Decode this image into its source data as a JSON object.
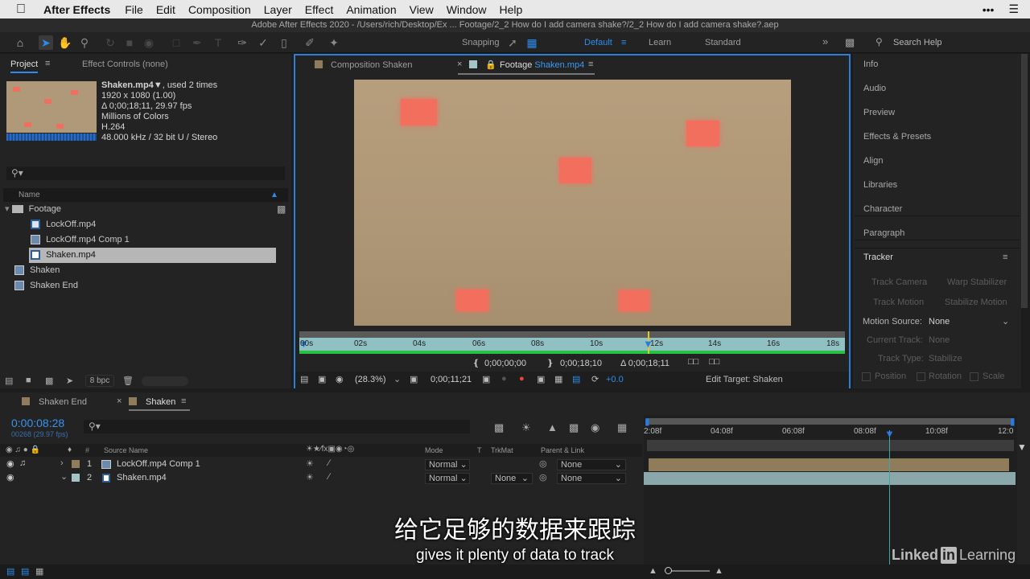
{
  "menubar": {
    "app_name": "After Effects",
    "items": [
      "File",
      "Edit",
      "Composition",
      "Layer",
      "Effect",
      "Animation",
      "View",
      "Window",
      "Help"
    ]
  },
  "window_title": "Adobe After Effects 2020 - /Users/rich/Desktop/Ex ... Footage/2_2 How do I add camera shake?/2_2 How do I add camera shake?.aep",
  "toolbar": {
    "snapping_label": "Snapping",
    "workspaces": [
      "Default",
      "Learn",
      "Standard"
    ],
    "search_placeholder": "Search Help"
  },
  "project": {
    "tab_project": "Project",
    "tab_effect_controls": "Effect Controls (none)",
    "info": {
      "name": "Shaken.mp4",
      "used": ", used 2 times",
      "res": "1920 x 1080 (1.00)",
      "duration": "Δ 0;00;18;11, 29.97 fps",
      "colors": "Millions of Colors",
      "codec": "H.264",
      "audio": "48.000 kHz / 32 bit U / Stereo"
    },
    "col_name": "Name",
    "items": [
      {
        "label": "Footage",
        "type": "folder"
      },
      {
        "label": "LockOff.mp4",
        "type": "footage"
      },
      {
        "label": "LockOff.mp4 Comp 1",
        "type": "comp"
      },
      {
        "label": "Shaken.mp4",
        "type": "footage",
        "selected": true
      },
      {
        "label": "Shaken",
        "type": "comp"
      },
      {
        "label": "Shaken End",
        "type": "comp"
      }
    ],
    "bpc": "8 bpc"
  },
  "viewer": {
    "tab_comp": "Composition Shaken",
    "tab_footage_prefix": "Footage ",
    "tab_footage_name": "Shaken.mp4",
    "ruler_ticks": [
      "00s",
      "02s",
      "04s",
      "06s",
      "08s",
      "10s",
      "12s",
      "14s",
      "16s",
      "18s"
    ],
    "in_time": "0;00;00;00",
    "out_time": "0;00;18;10",
    "duration": "Δ 0;00;18;11",
    "zoom": "(28.3%)",
    "current_time": "0;00;11;21",
    "exposure": "+0.0",
    "edit_target": "Edit Target: Shaken"
  },
  "right_panel": {
    "items": [
      "Info",
      "Audio",
      "Preview",
      "Effects & Presets",
      "Align",
      "Libraries",
      "Character",
      "Paragraph"
    ],
    "tracker": {
      "title": "Tracker",
      "track_camera": "Track Camera",
      "warp_stabilizer": "Warp Stabilizer",
      "track_motion": "Track Motion",
      "stabilize_motion": "Stabilize Motion",
      "motion_source_label": "Motion Source:",
      "motion_source_value": "None",
      "current_track_label": "Current Track:",
      "current_track_value": "None",
      "track_type_label": "Track Type:",
      "track_type_value": "Stabilize",
      "position": "Position",
      "rotation": "Rotation",
      "scale": "Scale"
    }
  },
  "timeline": {
    "tabs": [
      "Shaken End",
      "Shaken"
    ],
    "timecode": "0:00:08:28",
    "frame_info": "00268 (29.97 fps)",
    "col_source": "Source Name",
    "col_mode": "Mode",
    "col_t": "T",
    "col_trkmat": "TrkMat",
    "col_parent": "Parent & Link",
    "ruler_ticks": [
      "2:08f",
      "04:08f",
      "06:08f",
      "08:08f",
      "10:08f",
      "12:0"
    ],
    "layers": [
      {
        "num": "1",
        "name": "LockOff.mp4 Comp 1",
        "mode": "Normal",
        "trkmat": "",
        "parent": "None",
        "color": "#8e7c5b"
      },
      {
        "num": "2",
        "name": "Shaken.mp4",
        "mode": "Normal",
        "trkmat": "None",
        "parent": "None",
        "color": "#a3c5c6"
      }
    ]
  },
  "subtitles": {
    "zh": "给它足够的数据来跟踪",
    "en": "gives it plenty of data to track"
  },
  "watermark": {
    "linked": "Linked",
    "in": "in",
    "learning": "Learning"
  }
}
